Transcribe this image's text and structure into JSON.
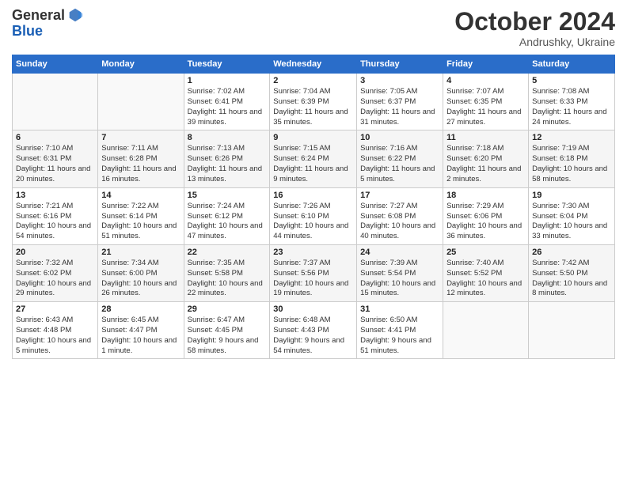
{
  "logo": {
    "general": "General",
    "blue": "Blue"
  },
  "header": {
    "month": "October 2024",
    "location": "Andrushky, Ukraine"
  },
  "weekdays": [
    "Sunday",
    "Monday",
    "Tuesday",
    "Wednesday",
    "Thursday",
    "Friday",
    "Saturday"
  ],
  "weeks": [
    [
      {
        "day": "",
        "info": ""
      },
      {
        "day": "",
        "info": ""
      },
      {
        "day": "1",
        "info": "Sunrise: 7:02 AM\nSunset: 6:41 PM\nDaylight: 11 hours and 39 minutes."
      },
      {
        "day": "2",
        "info": "Sunrise: 7:04 AM\nSunset: 6:39 PM\nDaylight: 11 hours and 35 minutes."
      },
      {
        "day": "3",
        "info": "Sunrise: 7:05 AM\nSunset: 6:37 PM\nDaylight: 11 hours and 31 minutes."
      },
      {
        "day": "4",
        "info": "Sunrise: 7:07 AM\nSunset: 6:35 PM\nDaylight: 11 hours and 27 minutes."
      },
      {
        "day": "5",
        "info": "Sunrise: 7:08 AM\nSunset: 6:33 PM\nDaylight: 11 hours and 24 minutes."
      }
    ],
    [
      {
        "day": "6",
        "info": "Sunrise: 7:10 AM\nSunset: 6:31 PM\nDaylight: 11 hours and 20 minutes."
      },
      {
        "day": "7",
        "info": "Sunrise: 7:11 AM\nSunset: 6:28 PM\nDaylight: 11 hours and 16 minutes."
      },
      {
        "day": "8",
        "info": "Sunrise: 7:13 AM\nSunset: 6:26 PM\nDaylight: 11 hours and 13 minutes."
      },
      {
        "day": "9",
        "info": "Sunrise: 7:15 AM\nSunset: 6:24 PM\nDaylight: 11 hours and 9 minutes."
      },
      {
        "day": "10",
        "info": "Sunrise: 7:16 AM\nSunset: 6:22 PM\nDaylight: 11 hours and 5 minutes."
      },
      {
        "day": "11",
        "info": "Sunrise: 7:18 AM\nSunset: 6:20 PM\nDaylight: 11 hours and 2 minutes."
      },
      {
        "day": "12",
        "info": "Sunrise: 7:19 AM\nSunset: 6:18 PM\nDaylight: 10 hours and 58 minutes."
      }
    ],
    [
      {
        "day": "13",
        "info": "Sunrise: 7:21 AM\nSunset: 6:16 PM\nDaylight: 10 hours and 54 minutes."
      },
      {
        "day": "14",
        "info": "Sunrise: 7:22 AM\nSunset: 6:14 PM\nDaylight: 10 hours and 51 minutes."
      },
      {
        "day": "15",
        "info": "Sunrise: 7:24 AM\nSunset: 6:12 PM\nDaylight: 10 hours and 47 minutes."
      },
      {
        "day": "16",
        "info": "Sunrise: 7:26 AM\nSunset: 6:10 PM\nDaylight: 10 hours and 44 minutes."
      },
      {
        "day": "17",
        "info": "Sunrise: 7:27 AM\nSunset: 6:08 PM\nDaylight: 10 hours and 40 minutes."
      },
      {
        "day": "18",
        "info": "Sunrise: 7:29 AM\nSunset: 6:06 PM\nDaylight: 10 hours and 36 minutes."
      },
      {
        "day": "19",
        "info": "Sunrise: 7:30 AM\nSunset: 6:04 PM\nDaylight: 10 hours and 33 minutes."
      }
    ],
    [
      {
        "day": "20",
        "info": "Sunrise: 7:32 AM\nSunset: 6:02 PM\nDaylight: 10 hours and 29 minutes."
      },
      {
        "day": "21",
        "info": "Sunrise: 7:34 AM\nSunset: 6:00 PM\nDaylight: 10 hours and 26 minutes."
      },
      {
        "day": "22",
        "info": "Sunrise: 7:35 AM\nSunset: 5:58 PM\nDaylight: 10 hours and 22 minutes."
      },
      {
        "day": "23",
        "info": "Sunrise: 7:37 AM\nSunset: 5:56 PM\nDaylight: 10 hours and 19 minutes."
      },
      {
        "day": "24",
        "info": "Sunrise: 7:39 AM\nSunset: 5:54 PM\nDaylight: 10 hours and 15 minutes."
      },
      {
        "day": "25",
        "info": "Sunrise: 7:40 AM\nSunset: 5:52 PM\nDaylight: 10 hours and 12 minutes."
      },
      {
        "day": "26",
        "info": "Sunrise: 7:42 AM\nSunset: 5:50 PM\nDaylight: 10 hours and 8 minutes."
      }
    ],
    [
      {
        "day": "27",
        "info": "Sunrise: 6:43 AM\nSunset: 4:48 PM\nDaylight: 10 hours and 5 minutes."
      },
      {
        "day": "28",
        "info": "Sunrise: 6:45 AM\nSunset: 4:47 PM\nDaylight: 10 hours and 1 minute."
      },
      {
        "day": "29",
        "info": "Sunrise: 6:47 AM\nSunset: 4:45 PM\nDaylight: 9 hours and 58 minutes."
      },
      {
        "day": "30",
        "info": "Sunrise: 6:48 AM\nSunset: 4:43 PM\nDaylight: 9 hours and 54 minutes."
      },
      {
        "day": "31",
        "info": "Sunrise: 6:50 AM\nSunset: 4:41 PM\nDaylight: 9 hours and 51 minutes."
      },
      {
        "day": "",
        "info": ""
      },
      {
        "day": "",
        "info": ""
      }
    ]
  ]
}
